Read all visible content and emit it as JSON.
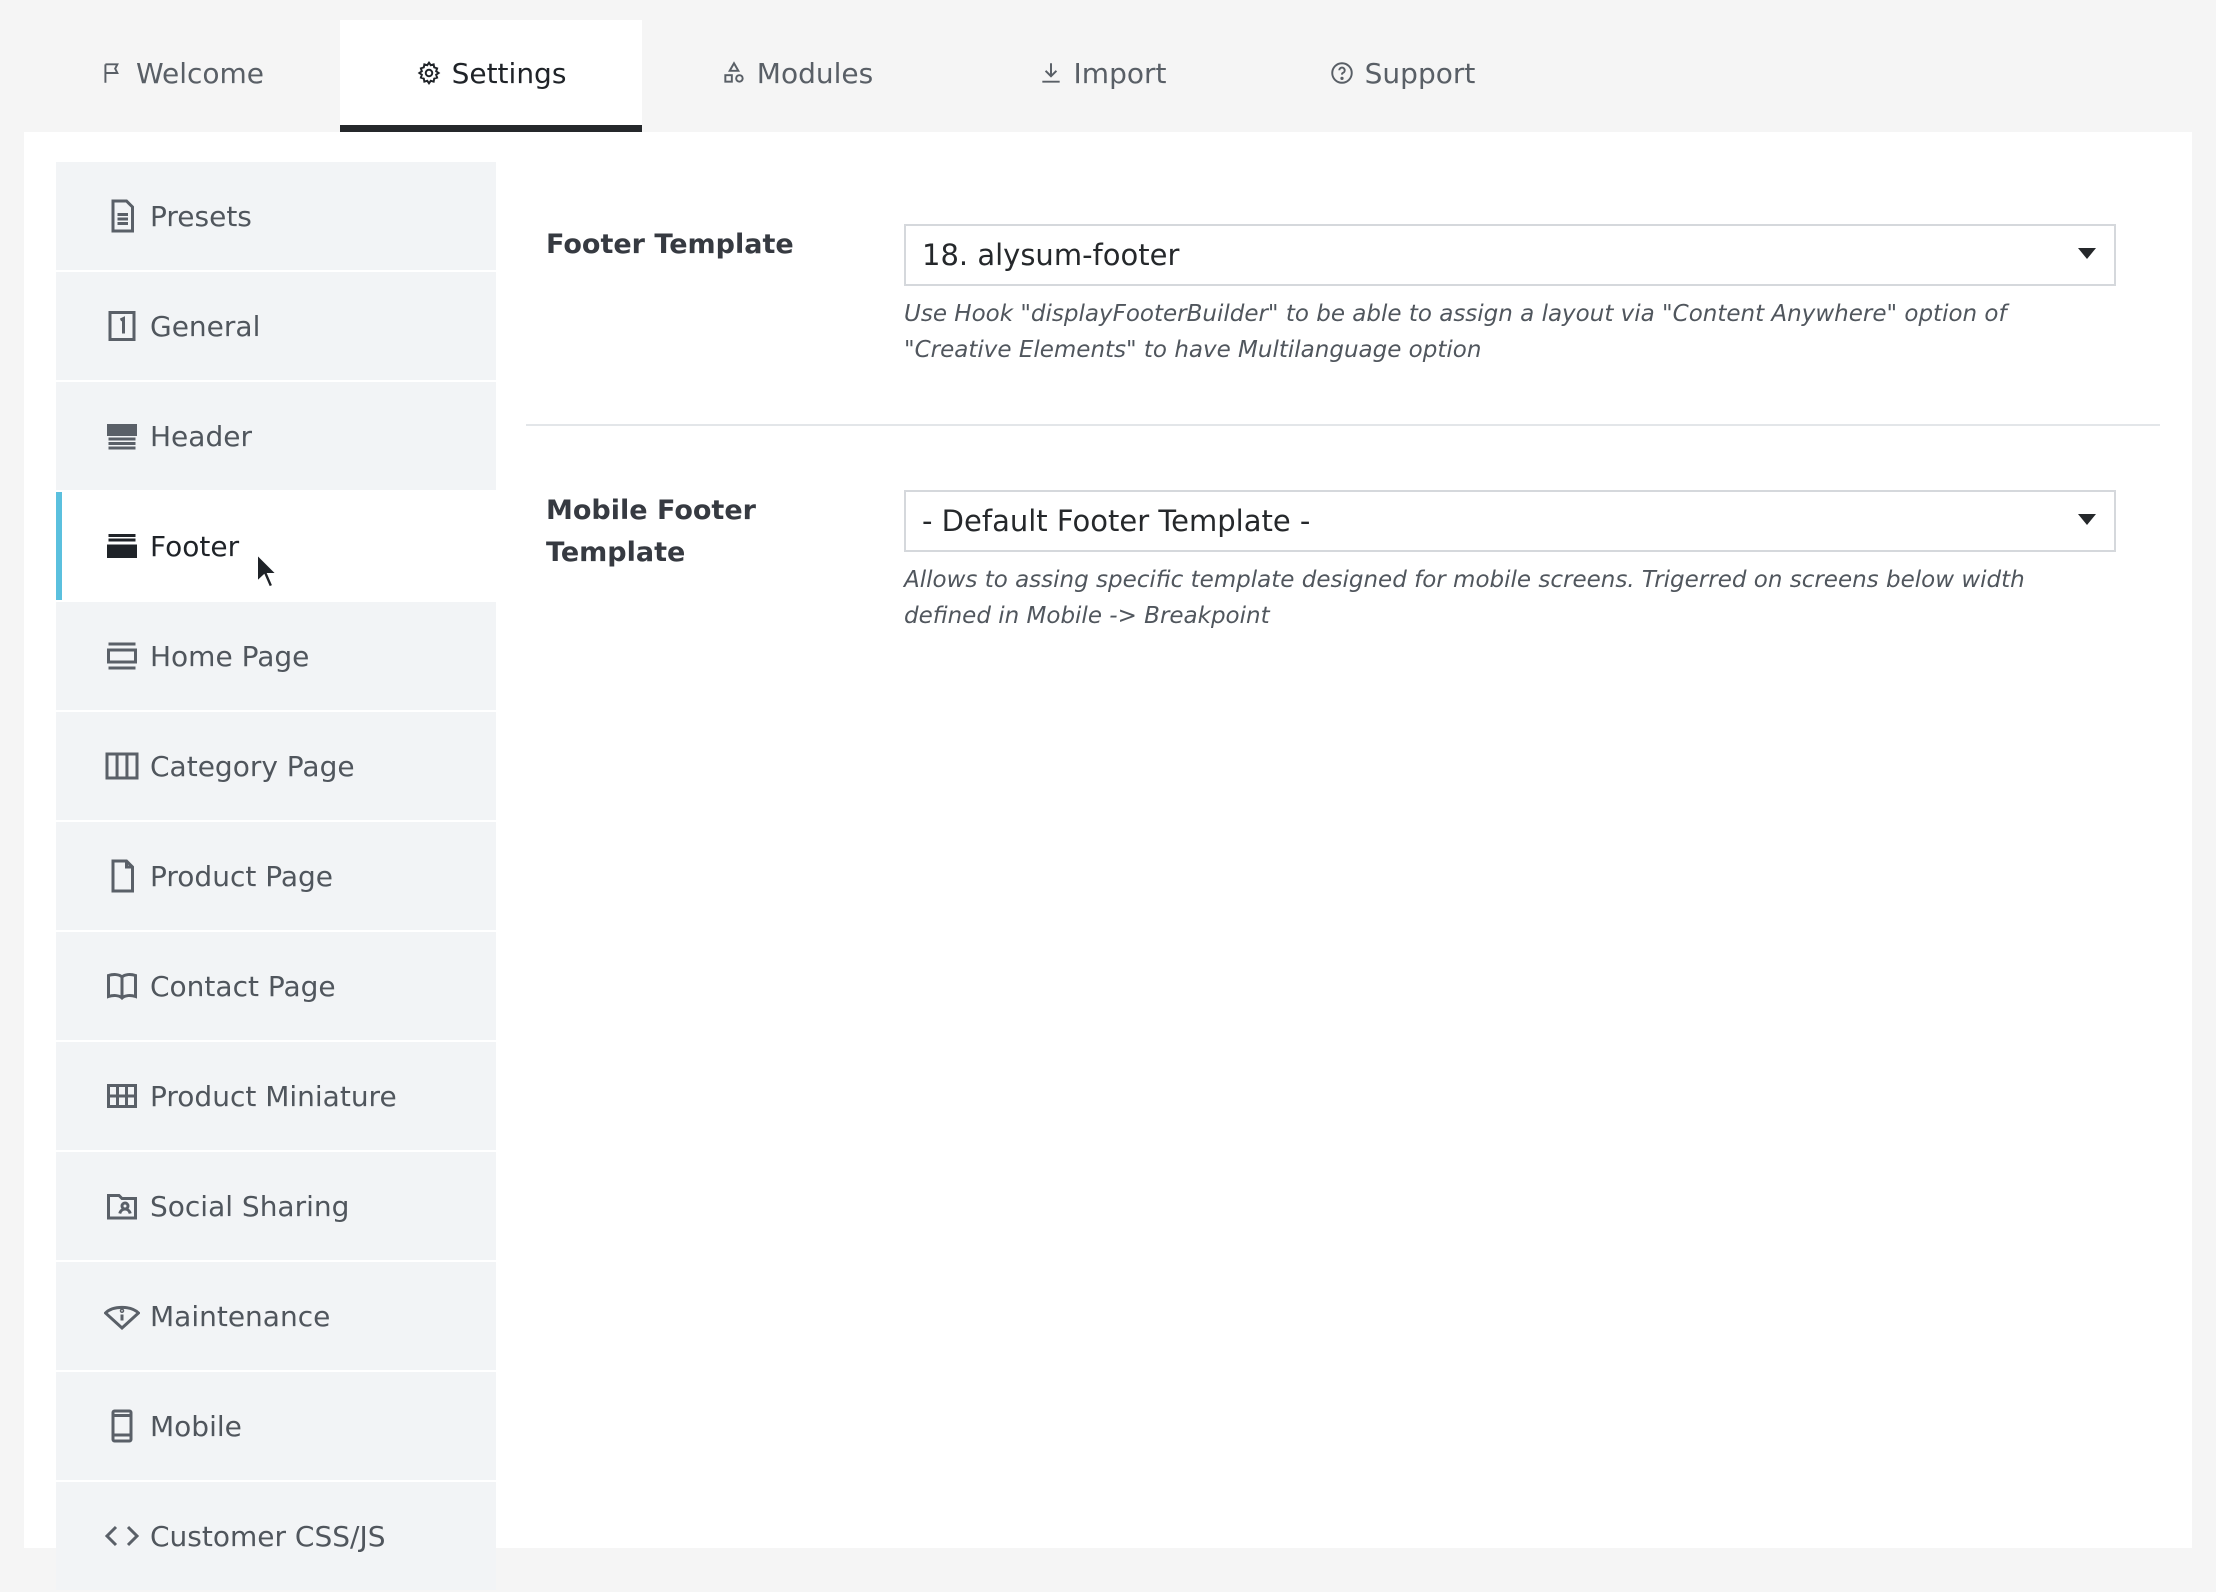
{
  "tabs": [
    {
      "label": "Welcome",
      "icon": "flag-icon"
    },
    {
      "label": "Settings",
      "icon": "gear-icon",
      "active": true
    },
    {
      "label": "Modules",
      "icon": "shapes-icon"
    },
    {
      "label": "Import",
      "icon": "download-icon"
    },
    {
      "label": "Support",
      "icon": "help-circle-icon"
    }
  ],
  "sidebar": {
    "items": [
      {
        "label": "Presets",
        "icon": "file-text-icon"
      },
      {
        "label": "General",
        "icon": "number-one-icon"
      },
      {
        "label": "Header",
        "icon": "header-layout-icon"
      },
      {
        "label": "Footer",
        "icon": "footer-layout-icon",
        "active": true
      },
      {
        "label": "Home Page",
        "icon": "home-layout-icon"
      },
      {
        "label": "Category Page",
        "icon": "columns-icon"
      },
      {
        "label": "Product Page",
        "icon": "file-icon"
      },
      {
        "label": "Contact Page",
        "icon": "book-icon"
      },
      {
        "label": "Product Miniature",
        "icon": "grid-icon"
      },
      {
        "label": "Social Sharing",
        "icon": "folder-user-icon"
      },
      {
        "label": "Maintenance",
        "icon": "eye-info-icon"
      },
      {
        "label": "Mobile",
        "icon": "mobile-icon"
      },
      {
        "label": "Customer CSS/JS",
        "icon": "code-icon"
      }
    ]
  },
  "content": {
    "footer_template": {
      "label": "Footer Template",
      "selected": "18. alysum-footer",
      "help": "Use Hook \"displayFooterBuilder\" to be able to assign a layout via \"Content Anywhere\" option of \"Creative Elements\" to have Multilanguage option"
    },
    "mobile_footer_template": {
      "label": "Mobile Footer Template",
      "selected": "- Default Footer Template -",
      "help": "Allows to assing specific template designed for mobile screens. Trigerred on screens below width defined in Mobile -> Breakpoint"
    }
  },
  "colors": {
    "active_accent": "#5bc0de",
    "tab_underline": "#25282b",
    "sidebar_bg": "#f2f4f6"
  }
}
